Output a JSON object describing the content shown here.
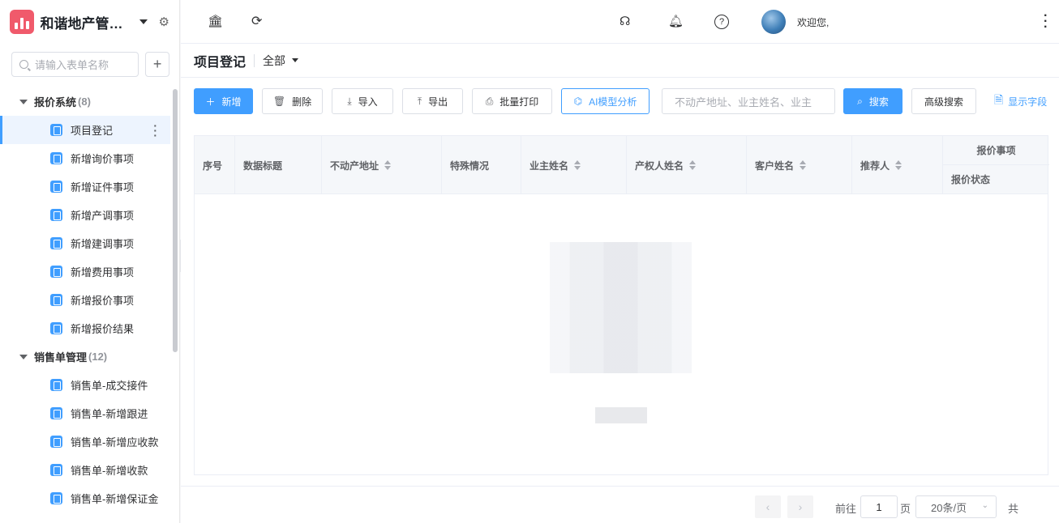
{
  "app": {
    "title": "和谐地产管理系统",
    "brand_color": "#f05a6b"
  },
  "sidebar": {
    "search_placeholder": "请输入表单名称",
    "add_label": "+",
    "groups": [
      {
        "label": "报价系统",
        "count": "(8)",
        "items": [
          "项目登记",
          "新增询价事项",
          "新增证件事项",
          "新增产调事项",
          "新增建调事项",
          "新增费用事项",
          "新增报价事项",
          "新增报价结果"
        ]
      },
      {
        "label": "销售单管理",
        "count": "(12)",
        "items": [
          "销售单-成交接件",
          "销售单-新增跟进",
          "销售单-新增应收款",
          "销售单-新增收款",
          "销售单-新增保证金"
        ]
      }
    ],
    "active_item": "项目登记"
  },
  "topbar": {
    "icons": [
      "bank-icon",
      "refresh-icon",
      "headset-icon",
      "bell-icon",
      "help-icon"
    ],
    "welcome": "欢迎您,"
  },
  "page": {
    "title": "项目登记",
    "filter": "全部"
  },
  "toolbar": {
    "new": "新增",
    "delete": "删除",
    "import": "导入",
    "export": "导出",
    "batch_print": "批量打印",
    "ai": "AI模型分析",
    "keyword_placeholder": "不动产地址、业主姓名、业主",
    "search": "搜索",
    "advanced": "高级搜索",
    "show_fields": "显示字段",
    "accent_color": "#409eff"
  },
  "table": {
    "columns": [
      "序号",
      "数据标题",
      "不动产地址",
      "特殊情况",
      "业主姓名",
      "产权人姓名",
      "客户姓名",
      "推荐人"
    ],
    "group_header": "报价事项",
    "group_sub": "报价状态"
  },
  "pagination": {
    "goto_label": "前往",
    "page_value": "1",
    "page_unit": "页",
    "page_size": "20条/页",
    "total_prefix": "共"
  }
}
